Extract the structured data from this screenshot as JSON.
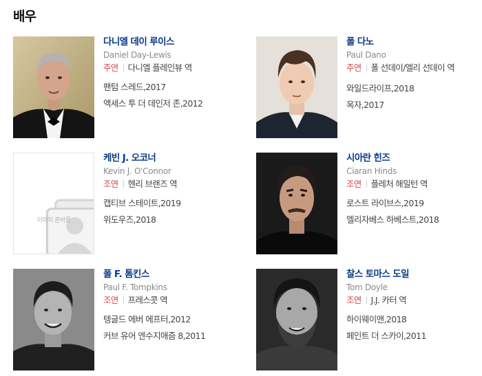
{
  "section": {
    "title": "배우"
  },
  "placeholder_text": "이미지 준비중",
  "actors": [
    {
      "name": "다니엘 데이 루이스",
      "english_name": "Daniel Day-Lewis",
      "role_type": "주연",
      "role": "다니엘 플레인뷰 역",
      "works": [
        "팬텀 스레드,2017",
        "액세스 투 더 데인저 존,2012"
      ]
    },
    {
      "name": "폴 다노",
      "english_name": "Paul Dano",
      "role_type": "주연",
      "role": "폴 선데이/엘리 선데이 역",
      "works": [
        "와일드라이프,2018",
        "옥자,2017"
      ]
    },
    {
      "name": "케빈 J. 오코너",
      "english_name": "Kevin J. O'Connor",
      "role_type": "조연",
      "role": "헨리 브랜즈 역",
      "works": [
        "캡티브 스테이트,2019",
        "위도우즈,2018"
      ]
    },
    {
      "name": "시아란 힌즈",
      "english_name": "Ciaran Hinds",
      "role_type": "조연",
      "role": "플레처 해밀턴 역",
      "works": [
        "로스트 라이브스,2019",
        "엘리자베스 하베스트,2018"
      ]
    },
    {
      "name": "폴 F. 톰킨스",
      "english_name": "Paul F. Tompkins",
      "role_type": "조연",
      "role": "프레스콧 역",
      "works": [
        "텡글드 에버 에프터,2012",
        "커브 유어 엔수지애즘 8,2011"
      ]
    },
    {
      "name": "찰스 토마스 도일",
      "english_name": "Tom Doyle",
      "role_type": "조연",
      "role": "J.J. 카터 역",
      "works": [
        "하이웨이맨,2018",
        "페인트 더 스카이,2011"
      ]
    }
  ]
}
